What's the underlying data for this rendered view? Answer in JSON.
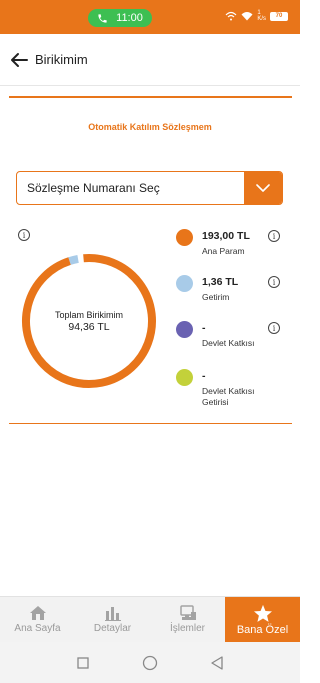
{
  "status_bar": {
    "call_time": "11:00",
    "network_speed": "1\nK/s",
    "battery": "70",
    "colors": {
      "background": "#e8751a",
      "call_pill": "#3dbf52"
    }
  },
  "header": {
    "title": "Birikimim",
    "back_icon": "arrow-left-icon"
  },
  "section": {
    "title": "Otomatik Katılım Sözleşmem"
  },
  "contract_select": {
    "value": "Sözleşme Numaranı Seç",
    "icon": "chevron-down-icon"
  },
  "summary": {
    "total_label": "Toplam Birikimim",
    "total_value": "94,36 TL",
    "info_icon": "info-icon"
  },
  "legend": [
    {
      "value": "193,00 TL",
      "label": "Ana Param",
      "color": "#e8751a",
      "share": 0.993,
      "info": true
    },
    {
      "value": "1,36 TL",
      "label": "Getirim",
      "color": "#a8cbe8",
      "share": 0.007,
      "info": true
    },
    {
      "value": "-",
      "label": "Devlet Katkısı",
      "color": "#6a62b2",
      "share": 0,
      "info": true
    },
    {
      "value": "-",
      "label": "Devlet Katkısı Getirisi",
      "color": "#c3d13a",
      "share": 0,
      "info": false
    }
  ],
  "bottom_nav": [
    {
      "label": "Ana Sayfa",
      "icon": "home-icon",
      "active": false
    },
    {
      "label": "Detaylar",
      "icon": "bar-chart-icon",
      "active": false
    },
    {
      "label": "İşlemler",
      "icon": "transactions-icon",
      "active": false
    },
    {
      "label": "Bana Özel",
      "icon": "star-icon",
      "active": true
    }
  ],
  "system_nav": [
    "recents-icon",
    "home-circle-icon",
    "back-triangle-icon"
  ],
  "colors": {
    "accent": "#e8751a"
  }
}
